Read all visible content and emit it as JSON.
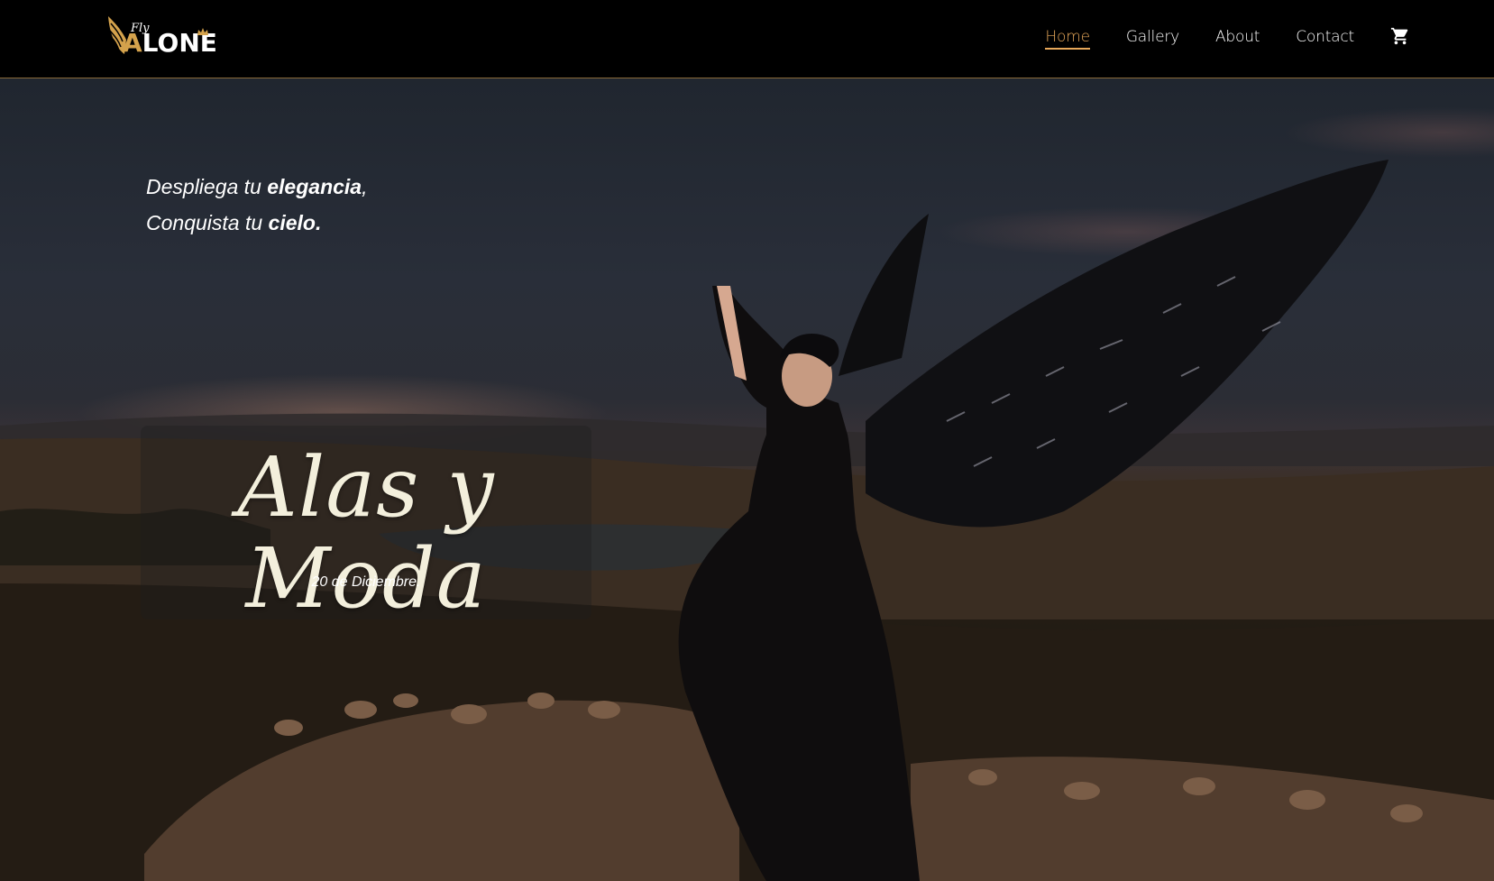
{
  "logo": {
    "fly": "Fly",
    "alone_a": "A",
    "alone_rest": "LONE"
  },
  "nav": {
    "links": [
      {
        "label": "Home",
        "active": true
      },
      {
        "label": "Gallery"
      },
      {
        "label": "About"
      },
      {
        "label": "Contact"
      }
    ],
    "cart_icon": "cart-icon"
  },
  "hero": {
    "tagline": {
      "line1_prefix": "Despliega tu ",
      "line1_bold": "elegancia",
      "line1_suffix": ",",
      "line2_prefix": "Conquista tu ",
      "line2_bold": "cielo."
    },
    "title": "Alas y Moda",
    "date": "20 de Diciembre."
  },
  "colors": {
    "accent": "#e8a85a",
    "gold": "#d4a24c",
    "title_cream": "#f3efdc"
  }
}
